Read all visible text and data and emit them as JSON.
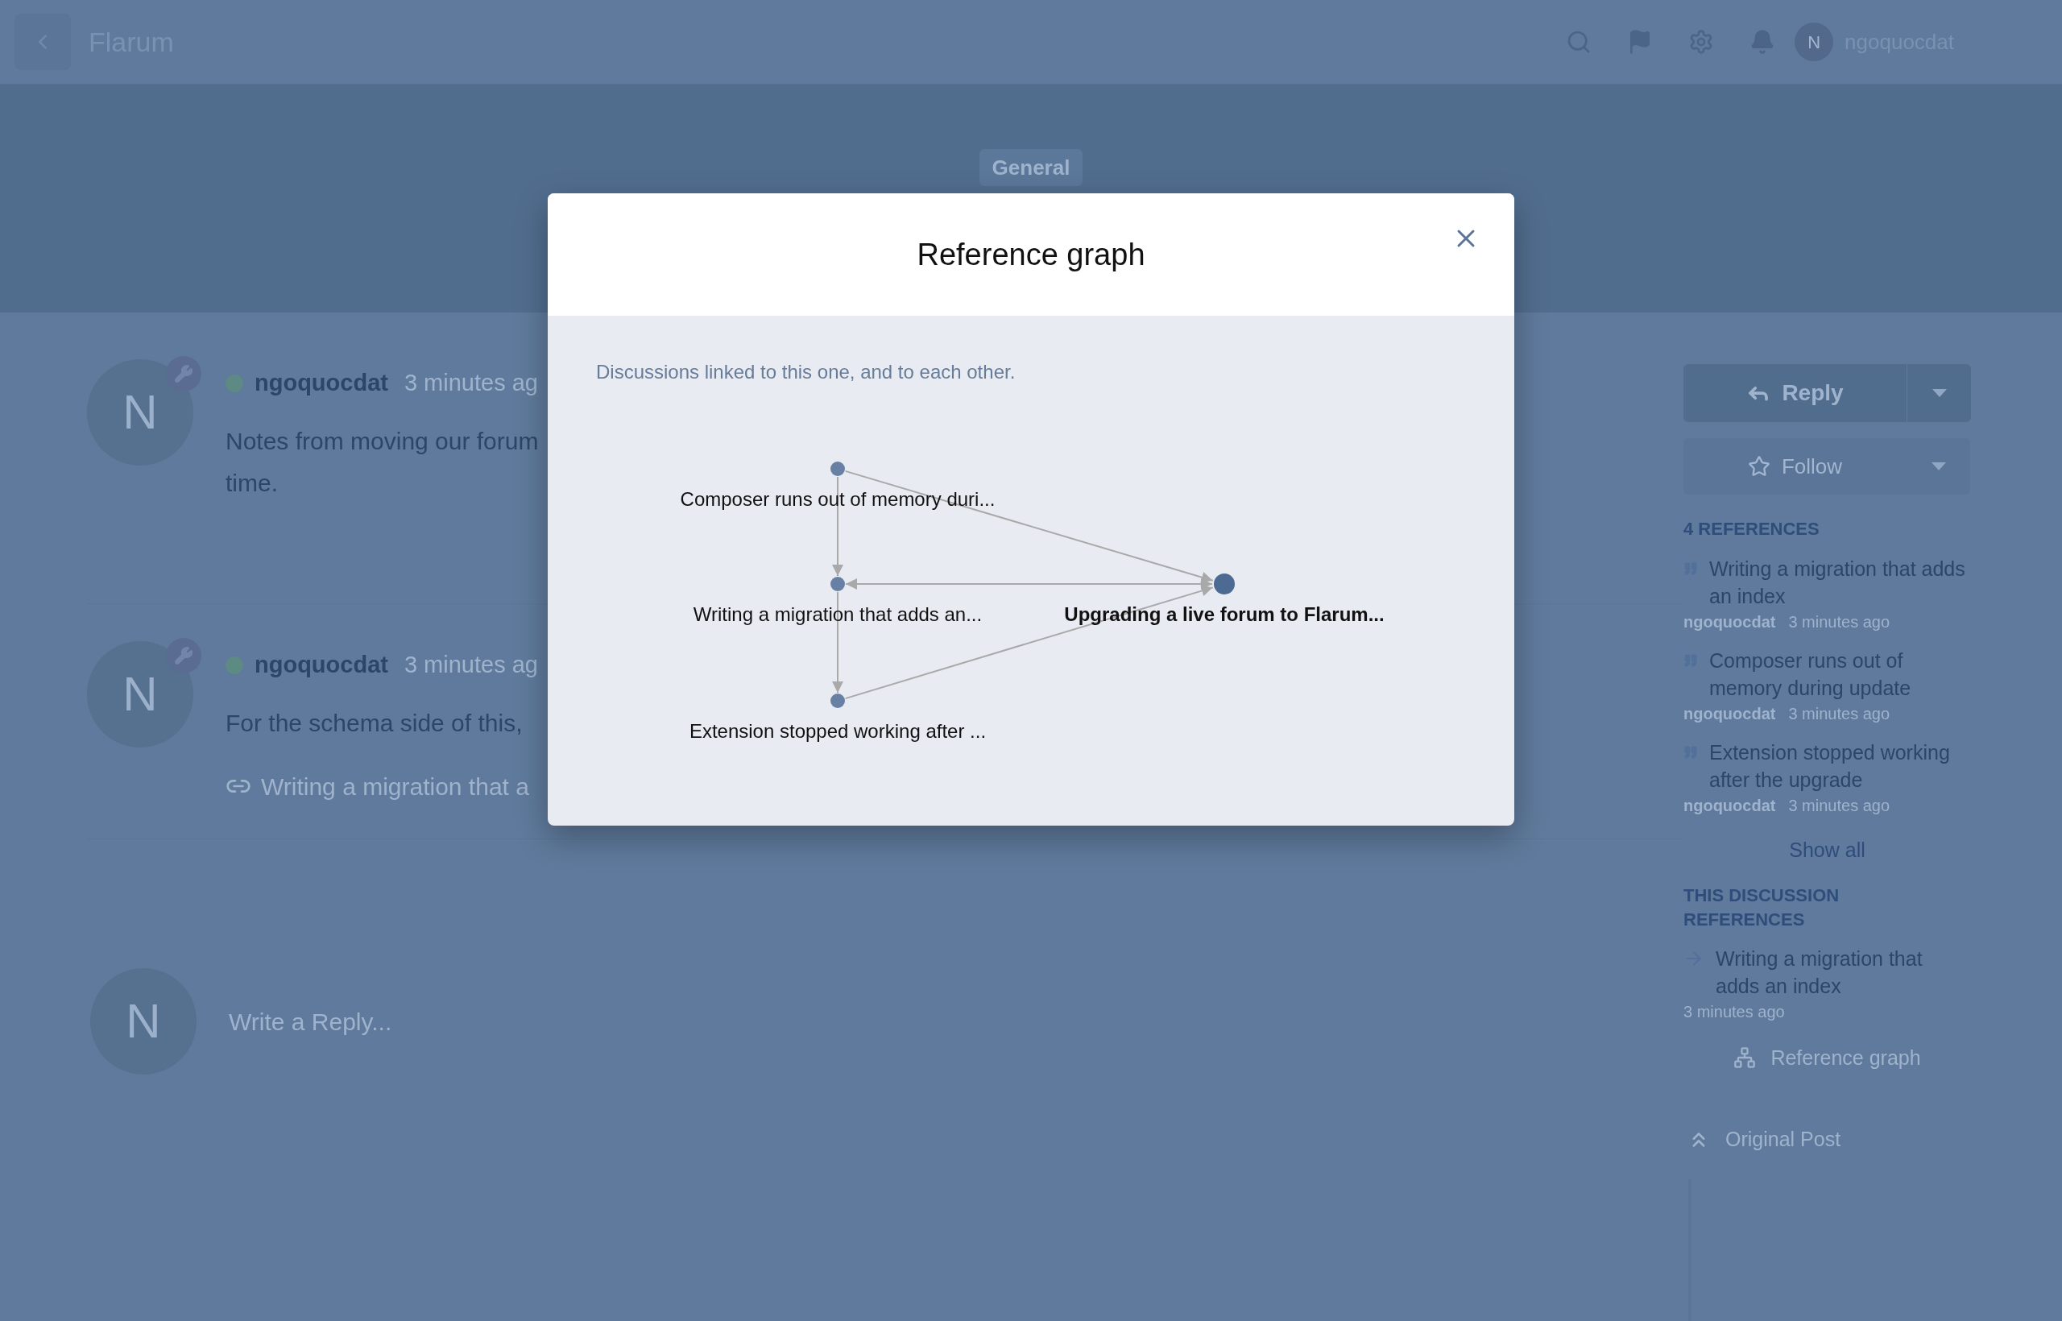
{
  "header": {
    "title": "Flarum",
    "user": {
      "avatar_letter": "N",
      "name": "ngoquocdat"
    }
  },
  "hero": {
    "tag": "General"
  },
  "posts": [
    {
      "avatar_letter": "N",
      "online": true,
      "username": "ngoquocdat",
      "time": "3 minutes ag",
      "body": [
        "Notes from moving our forum",
        "time."
      ]
    },
    {
      "avatar_letter": "N",
      "online": true,
      "username": "ngoquocdat",
      "time": "3 minutes ag",
      "body": [
        "For the schema side of this,"
      ],
      "link": "Writing a migration that a"
    }
  ],
  "composer": {
    "avatar_letter": "N",
    "placeholder": "Write a Reply..."
  },
  "sidebar": {
    "reply_button": "Reply",
    "follow_button": "Follow",
    "references_heading": "4 REFERENCES",
    "references": [
      {
        "title": "Writing a migration that adds an index",
        "author": "ngoquocdat",
        "time": "3 minutes ago"
      },
      {
        "title": "Composer runs out of memory during update",
        "author": "ngoquocdat",
        "time": "3 minutes ago"
      },
      {
        "title": "Extension stopped working after the upgrade",
        "author": "ngoquocdat",
        "time": "3 minutes ago"
      }
    ],
    "show_all": "Show all",
    "this_references_heading": "THIS DISCUSSION REFERENCES",
    "this_references": [
      {
        "title": "Writing a migration that adds an index",
        "time": "3 minutes ago"
      }
    ],
    "graph_link": "Reference graph",
    "original_post": "Original Post"
  },
  "modal": {
    "title": "Reference graph",
    "description": "Discussions linked to this one, and to each other.",
    "nodes": [
      {
        "label": "Composer runs out of memory duri...",
        "current": false
      },
      {
        "label": "Writing a migration that adds an...",
        "current": false
      },
      {
        "label": "Extension stopped working after ...",
        "current": false
      },
      {
        "label": "Upgrading a live forum to Flarum...",
        "current": true
      }
    ]
  }
}
